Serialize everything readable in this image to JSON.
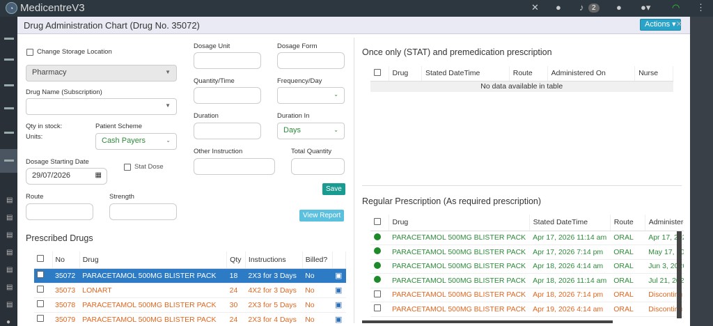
{
  "app": {
    "name": "MedicentreV3",
    "notif_count": "2"
  },
  "modal": {
    "title": "Drug Administration Chart (Drug No. 35072)",
    "actions_label": "Actions ▾",
    "close": "×"
  },
  "form": {
    "change_storage": "Change Storage Location",
    "storage_value": "Pharmacy",
    "drug_name_label": "Drug Name (Subscription)",
    "qty_stock": "Qty in stock:",
    "units": "Units:",
    "patient_scheme_label": "Patient Scheme",
    "patient_scheme_value": "Cash Payers",
    "dosage_start_label": "Dosage Starting Date",
    "dosage_start_value": "29/07/2026",
    "stat_dose": "Stat Dose",
    "route_label": "Route",
    "strength_label": "Strength",
    "dosage_unit_label": "Dosage Unit",
    "dosage_form_label": "Dosage Form",
    "qty_time_label": "Quantity/Time",
    "freq_label": "Frequency/Day",
    "duration_label": "Duration",
    "duration_in_label": "Duration In",
    "duration_in_value": "Days",
    "other_instr_label": "Other Instruction",
    "total_qty_label": "Total Quantity",
    "save_label": "Save",
    "view_report_label": "View Report"
  },
  "prescribed": {
    "title": "Prescribed Drugs",
    "headers": [
      "No",
      "Drug",
      "Qty",
      "Instructions",
      "Billed?"
    ],
    "rows": [
      {
        "no": "35072",
        "drug": "PARACETAMOL 500MG BLISTER PACK",
        "qty": "18",
        "instr": "2X3 for 3 Days",
        "billed": "No"
      },
      {
        "no": "35073",
        "drug": "LONART",
        "qty": "24",
        "instr": "4X2 for 3 Days",
        "billed": "No"
      },
      {
        "no": "35078",
        "drug": "PARACETAMOL 500MG BLISTER PACK",
        "qty": "30",
        "instr": "2X3 for 5 Days",
        "billed": "No"
      },
      {
        "no": "35079",
        "drug": "PARACETAMOL 500MG BLISTER PACK",
        "qty": "24",
        "instr": "2X3 for 4 Days",
        "billed": "No"
      }
    ]
  },
  "stat": {
    "title": "Once only (STAT) and premedication prescription",
    "headers": [
      "Drug",
      "Stated DateTime",
      "Route",
      "Administered On",
      "Nurse"
    ],
    "empty": "No data available in table"
  },
  "regular": {
    "title": "Regular Prescription (As required prescription)",
    "headers": [
      "Drug",
      "Stated DateTime",
      "Route",
      "Administere"
    ],
    "rows": [
      {
        "drug": "PARACETAMOL 500MG BLISTER PACK",
        "dt": "Apr 17, 2026 11:14 am",
        "route": "ORAL",
        "admin": "Apr 17, 2026"
      },
      {
        "drug": "PARACETAMOL 500MG BLISTER PACK",
        "dt": "Apr 17, 2026 7:14 pm",
        "route": "ORAL",
        "admin": "May 17, 2026"
      },
      {
        "drug": "PARACETAMOL 500MG BLISTER PACK",
        "dt": "Apr 18, 2026 4:14 am",
        "route": "ORAL",
        "admin": "Jun 3, 2026"
      },
      {
        "drug": "PARACETAMOL 500MG BLISTER PACK",
        "dt": "Apr 18, 2026 11:14 am",
        "route": "ORAL",
        "admin": "Jul 21, 2026"
      },
      {
        "drug": "PARACETAMOL 500MG BLISTER PACK",
        "dt": "Apr 18, 2026 7:14 pm",
        "route": "ORAL",
        "admin": "Discontinu"
      },
      {
        "drug": "PARACETAMOL 500MG BLISTER PACK",
        "dt": "Apr 19, 2026 4:14 am",
        "route": "ORAL",
        "admin": "Discontinu"
      }
    ]
  }
}
